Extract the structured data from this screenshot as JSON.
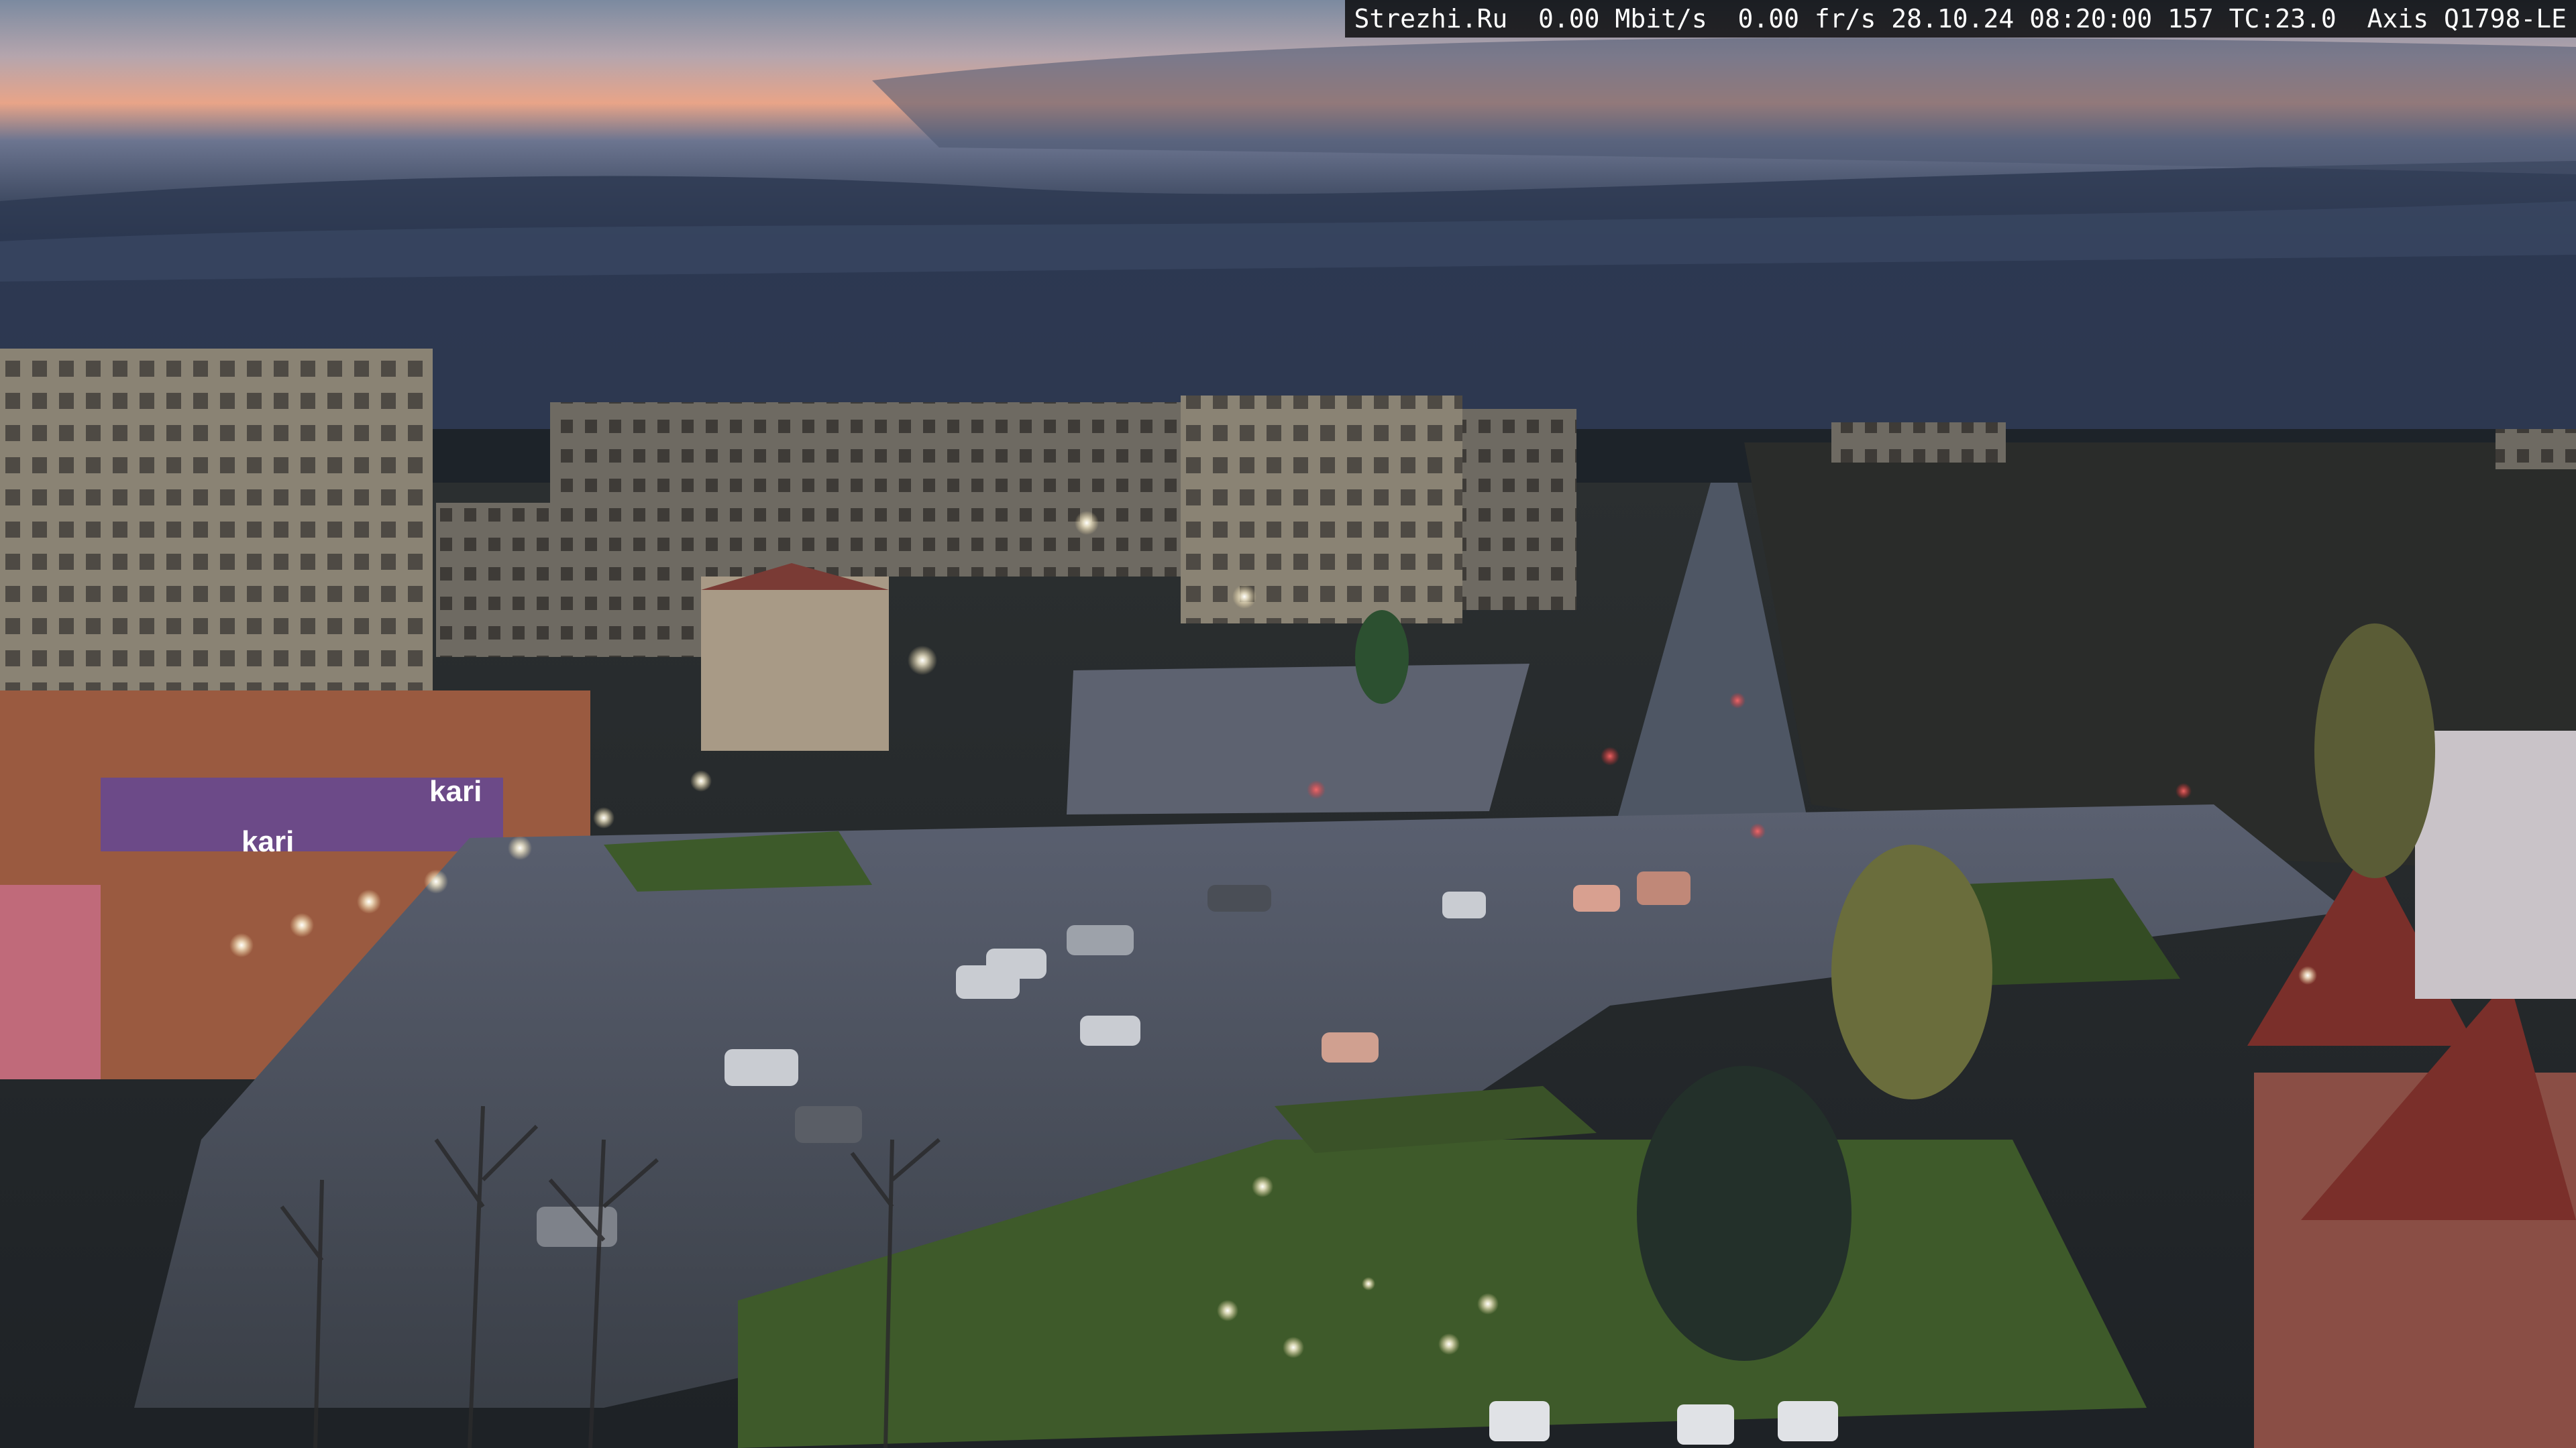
{
  "overlay": {
    "site": "Strezhi.Ru",
    "bitrate": "0.00 Mbit/s",
    "framerate": "0.00 fr/s",
    "date": "28.10.24",
    "time": "08:20:00",
    "frame_no": "157",
    "tc": "TC:23.0",
    "camera": "Axis Q1798-LE"
  },
  "signs": {
    "store_left": "kari",
    "store_right": "kari"
  },
  "colors": {
    "sky_top": "#6f7f96",
    "sky_glow": "#e8a488",
    "cloud_dark": "#27344a",
    "road": "#3a3f47",
    "grass": "#3e5a2a",
    "building_tan": "#8a8374",
    "building_red": "#8a4e45",
    "store_facade": "#6c4a88"
  }
}
